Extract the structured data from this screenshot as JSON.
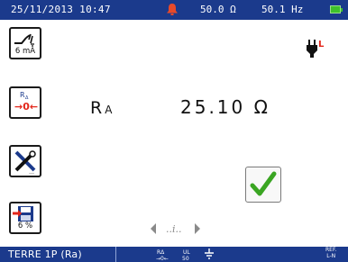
{
  "status_bar": {
    "datetime": "25/11/2013 10:47",
    "resistance": "50.0 Ω",
    "frequency": "50.1 Hz",
    "alarm_icon": "bell-alarm-icon",
    "battery_icon": "battery-full-icon",
    "battery_color": "#3fc22c"
  },
  "side_buttons": [
    {
      "icon": "ground-fault-current-icon",
      "caption": "6 mA"
    },
    {
      "icon": "ra-zero-reset-icon",
      "caption": ""
    },
    {
      "icon": "tools-settings-icon",
      "caption": ""
    },
    {
      "icon": "save-memory-icon",
      "caption": "6 %"
    }
  ],
  "measurement": {
    "label": "R",
    "label_sub": "A",
    "value": "25.10 Ω"
  },
  "result_icon": "checkmark-pass-icon",
  "mode_bar": {
    "mode": "TERRE 1P (Ra)",
    "ref_line1": "REF.",
    "ref_line2": "L-N"
  },
  "colors": {
    "bar_bg": "#1b3a8c",
    "check_green": "#3aa522",
    "reset_red": "#e3261a",
    "alarm_red": "#e84a2a"
  }
}
